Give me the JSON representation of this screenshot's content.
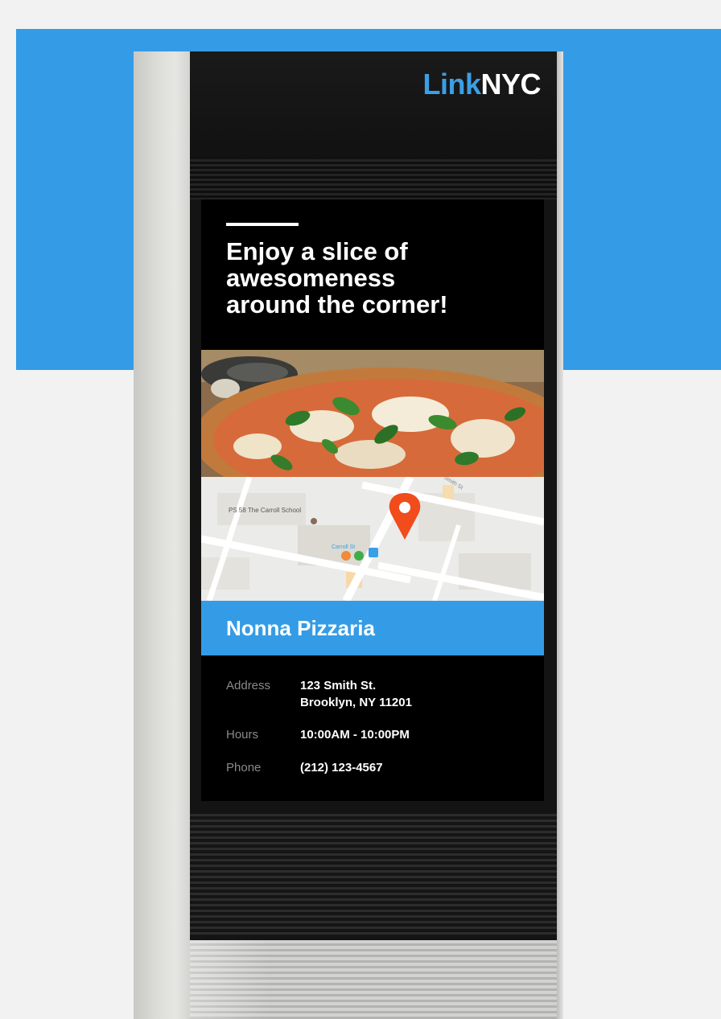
{
  "brand": {
    "part1": "Link",
    "part2": "NYC"
  },
  "headline": {
    "line1": "Enjoy a slice of",
    "line2": "awesomeness",
    "line3": "around the corner!"
  },
  "map": {
    "school_label": "PS 58 The Carroll School",
    "station_label": "Carroll St",
    "street_label": "Smith St"
  },
  "venue": {
    "name": "Nonna Pizzaria"
  },
  "details": {
    "address_label": "Address",
    "address_line1": "123 Smith St.",
    "address_line2": "Brooklyn, NY 11201",
    "hours_label": "Hours",
    "hours_value": "10:00AM - 10:00PM",
    "phone_label": "Phone",
    "phone_value": "(212) 123-4567"
  },
  "colors": {
    "accent": "#349ce6",
    "pin": "#f04c1c",
    "screen": "#000000"
  }
}
